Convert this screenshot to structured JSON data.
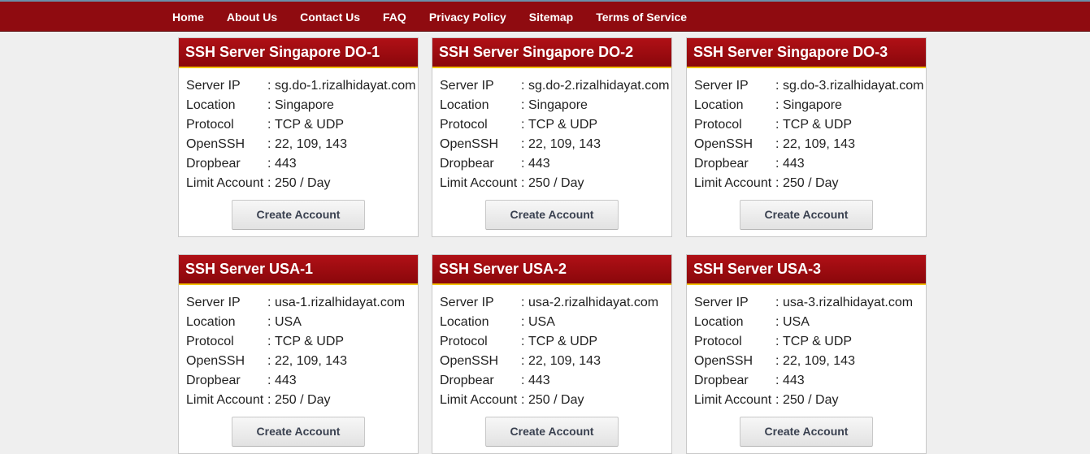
{
  "nav": {
    "items": [
      "Home",
      "About Us",
      "Contact Us",
      "FAQ",
      "Privacy Policy",
      "Sitemap",
      "Terms of Service"
    ]
  },
  "servers": [
    {
      "title": "SSH Server Singapore DO-1",
      "rows": [
        {
          "label": "Server IP",
          "value": "sg.do-1.rizalhidayat.com"
        },
        {
          "label": "Location",
          "value": "Singapore"
        },
        {
          "label": "Protocol",
          "value": "TCP & UDP"
        },
        {
          "label": "OpenSSH",
          "value": "22, 109, 143"
        },
        {
          "label": "Dropbear",
          "value": "443"
        },
        {
          "label": "Limit Account",
          "value": "250 / Day"
        }
      ],
      "button": "Create Account"
    },
    {
      "title": "SSH Server Singapore DO-2",
      "rows": [
        {
          "label": "Server IP",
          "value": "sg.do-2.rizalhidayat.com"
        },
        {
          "label": "Location",
          "value": "Singapore"
        },
        {
          "label": "Protocol",
          "value": "TCP & UDP"
        },
        {
          "label": "OpenSSH",
          "value": "22, 109, 143"
        },
        {
          "label": "Dropbear",
          "value": "443"
        },
        {
          "label": "Limit Account",
          "value": "250 / Day"
        }
      ],
      "button": "Create Account"
    },
    {
      "title": "SSH Server Singapore DO-3",
      "rows": [
        {
          "label": "Server IP",
          "value": "sg.do-3.rizalhidayat.com"
        },
        {
          "label": "Location",
          "value": "Singapore"
        },
        {
          "label": "Protocol",
          "value": "TCP & UDP"
        },
        {
          "label": "OpenSSH",
          "value": "22, 109, 143"
        },
        {
          "label": "Dropbear",
          "value": "443"
        },
        {
          "label": "Limit Account",
          "value": "250 / Day"
        }
      ],
      "button": "Create Account"
    },
    {
      "title": "SSH Server USA-1",
      "rows": [
        {
          "label": "Server IP",
          "value": "usa-1.rizalhidayat.com"
        },
        {
          "label": "Location",
          "value": "USA"
        },
        {
          "label": "Protocol",
          "value": "TCP & UDP"
        },
        {
          "label": "OpenSSH",
          "value": "22, 109, 143"
        },
        {
          "label": "Dropbear",
          "value": "443"
        },
        {
          "label": "Limit Account",
          "value": "250 / Day"
        }
      ],
      "button": "Create Account"
    },
    {
      "title": "SSH Server USA-2",
      "rows": [
        {
          "label": "Server IP",
          "value": "usa-2.rizalhidayat.com"
        },
        {
          "label": "Location",
          "value": "USA"
        },
        {
          "label": "Protocol",
          "value": "TCP & UDP"
        },
        {
          "label": "OpenSSH",
          "value": "22, 109, 143"
        },
        {
          "label": "Dropbear",
          "value": "443"
        },
        {
          "label": "Limit Account",
          "value": "250 / Day"
        }
      ],
      "button": "Create Account"
    },
    {
      "title": "SSH Server USA-3",
      "rows": [
        {
          "label": "Server IP",
          "value": "usa-3.rizalhidayat.com"
        },
        {
          "label": "Location",
          "value": "USA"
        },
        {
          "label": "Protocol",
          "value": "TCP & UDP"
        },
        {
          "label": "OpenSSH",
          "value": "22, 109, 143"
        },
        {
          "label": "Dropbear",
          "value": "443"
        },
        {
          "label": "Limit Account",
          "value": "250 / Day"
        }
      ],
      "button": "Create Account"
    }
  ],
  "separator": ":"
}
